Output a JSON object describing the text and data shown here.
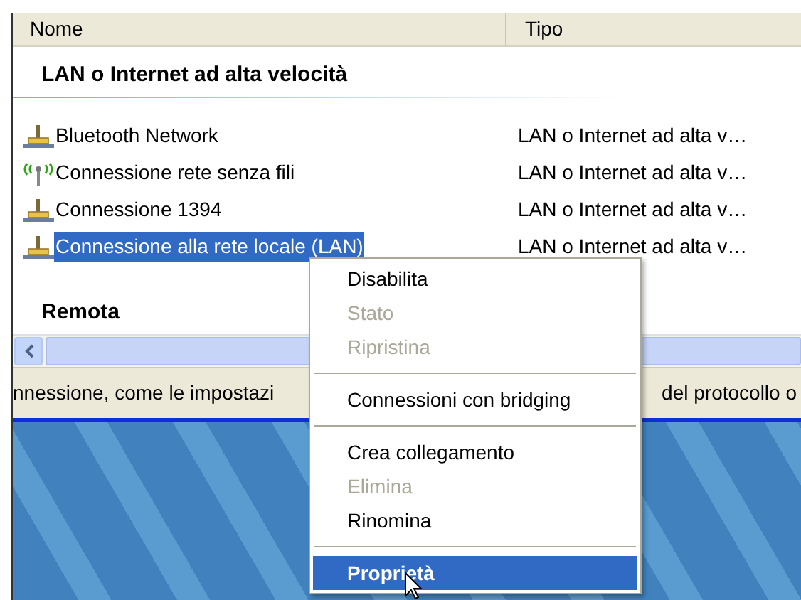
{
  "columns": [
    "Nome",
    "Tipo"
  ],
  "groups": [
    {
      "title": "LAN o Internet ad alta velocità",
      "items": [
        {
          "name": "Bluetooth Network",
          "type": "LAN o Internet ad alta v…",
          "kind": "wired",
          "selected": false
        },
        {
          "name": "Connessione rete senza fili",
          "type": "LAN o Internet ad alta v…",
          "kind": "wireless",
          "selected": false
        },
        {
          "name": "Connessione 1394",
          "type": "LAN o Internet ad alta v…",
          "kind": "wired",
          "selected": false
        },
        {
          "name": "Connessione alla rete locale (LAN)",
          "type": "LAN o Internet ad alta v…",
          "kind": "wired",
          "selected": true
        }
      ]
    },
    {
      "title": "Remota"
    }
  ],
  "status_bar": {
    "left": "nnessione, come le impostazi",
    "right": "del protocollo o"
  },
  "context_menu": [
    {
      "kind": "item",
      "label": "Disabilita",
      "disabled": false,
      "selected": false
    },
    {
      "kind": "item",
      "label": "Stato",
      "disabled": true,
      "selected": false
    },
    {
      "kind": "item",
      "label": "Ripristina",
      "disabled": true,
      "selected": false
    },
    {
      "kind": "separator"
    },
    {
      "kind": "item",
      "label": "Connessioni con bridging",
      "disabled": false,
      "selected": false
    },
    {
      "kind": "separator"
    },
    {
      "kind": "item",
      "label": "Crea collegamento",
      "disabled": false,
      "selected": false
    },
    {
      "kind": "item",
      "label": "Elimina",
      "disabled": true,
      "selected": false
    },
    {
      "kind": "item",
      "label": "Rinomina",
      "disabled": false,
      "selected": false
    },
    {
      "kind": "separator"
    },
    {
      "kind": "item",
      "label": "Proprietà",
      "disabled": false,
      "selected": true
    }
  ]
}
